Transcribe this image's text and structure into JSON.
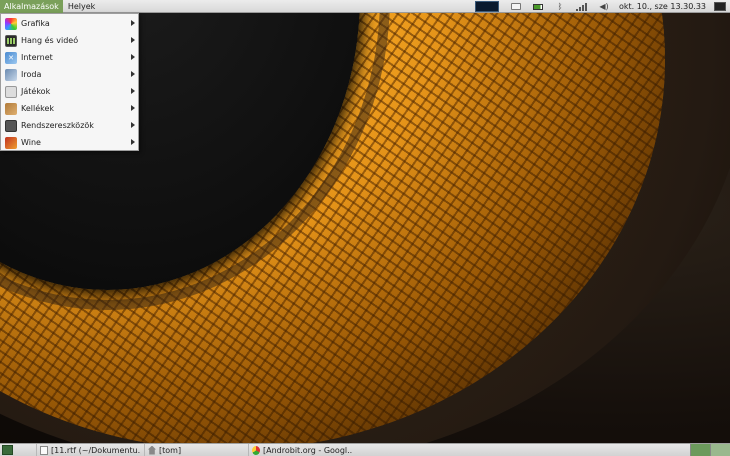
{
  "top_panel": {
    "applications_label": "Alkalmazások",
    "places_label": "Helyek",
    "clock": "okt. 10., sze 13.30.33",
    "tray_icons": [
      "workspace-preview",
      "keyboard-icon",
      "battery-icon",
      "bluetooth-icon",
      "signal-icon",
      "volume-icon",
      "session-icon"
    ]
  },
  "app_menu": {
    "items": [
      {
        "label": "Grafika",
        "icon": "graphics-icon"
      },
      {
        "label": "Hang és videó",
        "icon": "sound-video-icon"
      },
      {
        "label": "Internet",
        "icon": "internet-icon"
      },
      {
        "label": "Iroda",
        "icon": "office-icon"
      },
      {
        "label": "Játékok",
        "icon": "games-icon"
      },
      {
        "label": "Kellékek",
        "icon": "accessories-icon"
      },
      {
        "label": "Rendszereszközök",
        "icon": "system-tools-icon"
      },
      {
        "label": "Wine",
        "icon": "wine-icon"
      }
    ]
  },
  "bottom_panel": {
    "tasks": [
      {
        "label": "[11.rtf (~/Dokumentu...",
        "icon": "document-icon"
      },
      {
        "label": "[tom]",
        "icon": "home-folder-icon"
      },
      {
        "label": "[Androbit.org - Googl...",
        "icon": "chrome-icon"
      }
    ],
    "workspaces": [
      "active",
      "inactive"
    ]
  },
  "colors": {
    "panel_bg": "#e0e0e0",
    "menu_highlight": "#7aa05a",
    "cone_orange": "#f0a020"
  }
}
